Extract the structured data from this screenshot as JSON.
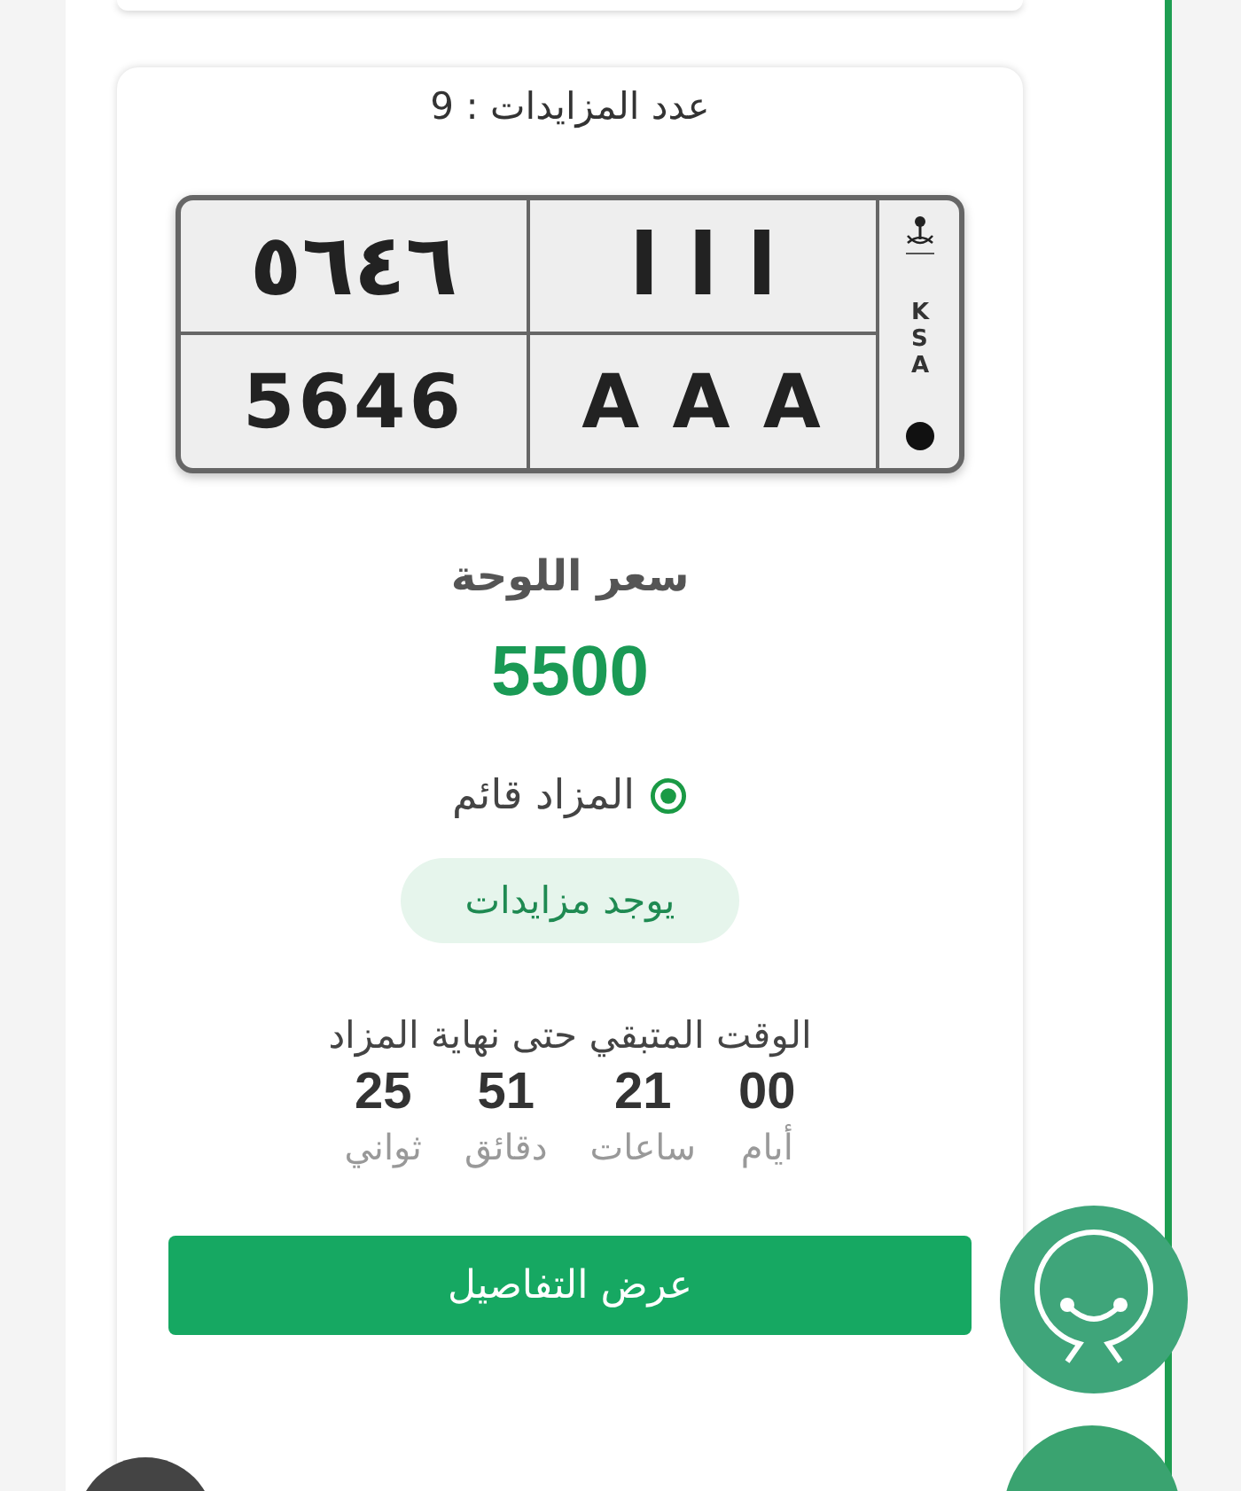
{
  "bids_count": "عدد المزايدات : 9",
  "plate": {
    "arabic_numbers": "٥٦٤٦",
    "latin_numbers": "5646",
    "arabic_letters": "ا ا ا",
    "latin_letters": "A A A",
    "country": "KSA"
  },
  "price_label": "سعر اللوحة",
  "price": "5500",
  "status": {
    "label": "المزاد قائم",
    "active": true
  },
  "bids_badge": "يوجد مزايدات",
  "countdown": {
    "label": "الوقت المتبقي حتى نهاية المزاد",
    "units": [
      {
        "value": "00",
        "label": "أيام"
      },
      {
        "value": "21",
        "label": "ساعات"
      },
      {
        "value": "51",
        "label": "دقائق"
      },
      {
        "value": "25",
        "label": "ثواني"
      }
    ]
  },
  "details_button": "عرض التفاصيل"
}
